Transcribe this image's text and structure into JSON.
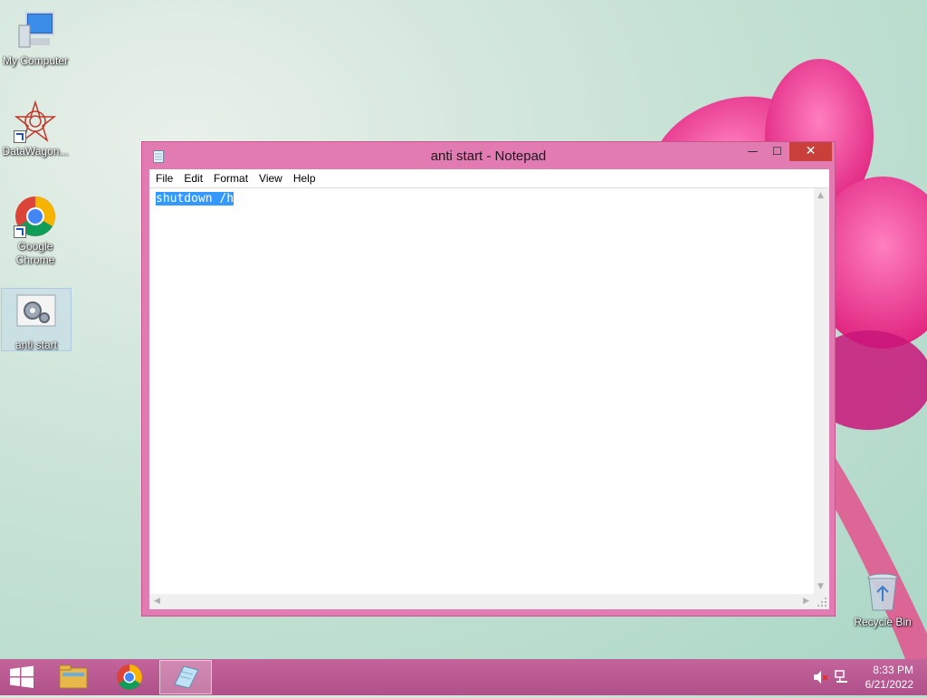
{
  "desktop": {
    "icons": [
      {
        "label": "My Computer"
      },
      {
        "label": "DataWagon..."
      },
      {
        "label": "Google Chrome"
      },
      {
        "label": "anti start"
      },
      {
        "label": "Recycle Bin"
      }
    ]
  },
  "window": {
    "title": "anti start - Notepad",
    "controls": {
      "minimize": "—",
      "maximize": "☐",
      "close": "✕"
    },
    "menu": [
      "File",
      "Edit",
      "Format",
      "View",
      "Help"
    ],
    "content": "shutdown /h"
  },
  "taskbar": {
    "clock_time": "8:33 PM",
    "clock_date": "6/21/2022"
  },
  "colors": {
    "window_frame": "#e27bb2",
    "taskbar": "#b8558f",
    "close_button": "#c9403b",
    "selection": "#3399ff"
  }
}
